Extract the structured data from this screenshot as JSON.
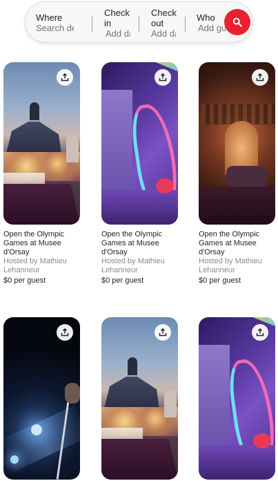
{
  "search": {
    "where_label": "Where",
    "where_placeholder": "Search destinations",
    "checkin_label": "Check in",
    "checkin_placeholder": "Add dates",
    "checkout_label": "Check out",
    "checkout_placeholder": "Add dates",
    "who_label": "Who",
    "who_placeholder": "Add guests",
    "button_icon": "search-icon",
    "accent_color": "#e8202f"
  },
  "listings": [
    {
      "title": "Open the Olympic Games at Musee d'Orsay",
      "host": "Hosted by Mathieu Lehanneur",
      "price": "$0 per guest"
    },
    {
      "title": "Open the Olympic Games at Musee d'Orsay",
      "host": "Hosted by Mathieu Lehanneur",
      "price": "$0 per guest"
    },
    {
      "title": "Open the Olympic Games at Musee d'Orsay",
      "host": "Hosted by Mathieu Lehanneur",
      "price": "$0 per guest"
    }
  ],
  "share_icon": "share-upload-icon"
}
